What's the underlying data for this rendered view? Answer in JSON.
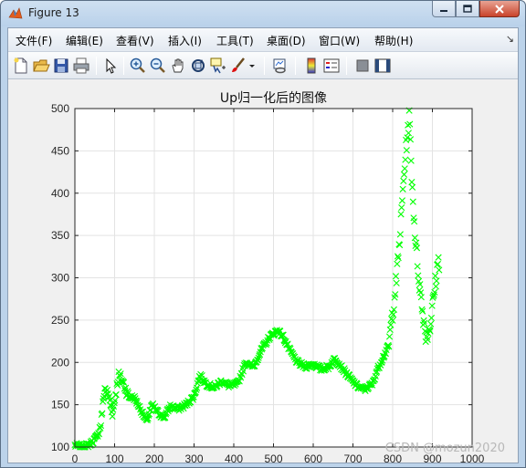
{
  "window": {
    "title": "Figure 13"
  },
  "menu": [
    {
      "label": "文件(F)"
    },
    {
      "label": "编辑(E)"
    },
    {
      "label": "查看(V)"
    },
    {
      "label": "插入(I)"
    },
    {
      "label": "工具(T)"
    },
    {
      "label": "桌面(D)"
    },
    {
      "label": "窗口(W)"
    },
    {
      "label": "帮助(H)"
    }
  ],
  "toolbar": {
    "icons": [
      "new-figure-icon",
      "open-icon",
      "save-icon",
      "print-icon",
      "pointer-icon",
      "zoom-in-icon",
      "zoom-out-icon",
      "pan-icon",
      "rotate-3d-icon",
      "data-cursor-icon",
      "brush-icon",
      "link-plot-icon",
      "colorbar-icon",
      "legend-icon",
      "hide-plot-tools-icon",
      "show-plot-tools-icon"
    ]
  },
  "watermark": "CSDN @mozun2020",
  "chart_data": {
    "type": "scatter",
    "title": "Up归一化后的图像",
    "xlabel": "",
    "ylabel": "",
    "xlim": [
      0,
      1000
    ],
    "ylim": [
      100,
      500
    ],
    "xticks": [
      0,
      100,
      200,
      300,
      400,
      500,
      600,
      700,
      800,
      900,
      1000
    ],
    "yticks": [
      100,
      150,
      200,
      250,
      300,
      350,
      400,
      450,
      500
    ],
    "grid": true,
    "marker": "x",
    "color": "#00ff00",
    "trend": [
      [
        0,
        102
      ],
      [
        20,
        100
      ],
      [
        40,
        104
      ],
      [
        55,
        112
      ],
      [
        65,
        125
      ],
      [
        75,
        170
      ],
      [
        85,
        160
      ],
      [
        95,
        140
      ],
      [
        110,
        185
      ],
      [
        120,
        178
      ],
      [
        135,
        160
      ],
      [
        150,
        158
      ],
      [
        165,
        145
      ],
      [
        180,
        130
      ],
      [
        195,
        150
      ],
      [
        210,
        140
      ],
      [
        225,
        135
      ],
      [
        240,
        148
      ],
      [
        260,
        145
      ],
      [
        280,
        150
      ],
      [
        300,
        160
      ],
      [
        315,
        185
      ],
      [
        330,
        175
      ],
      [
        350,
        170
      ],
      [
        370,
        178
      ],
      [
        390,
        172
      ],
      [
        410,
        175
      ],
      [
        430,
        200
      ],
      [
        450,
        195
      ],
      [
        470,
        215
      ],
      [
        490,
        230
      ],
      [
        510,
        238
      ],
      [
        525,
        230
      ],
      [
        540,
        215
      ],
      [
        560,
        200
      ],
      [
        580,
        195
      ],
      [
        600,
        198
      ],
      [
        620,
        192
      ],
      [
        640,
        195
      ],
      [
        655,
        205
      ],
      [
        670,
        195
      ],
      [
        690,
        183
      ],
      [
        710,
        172
      ],
      [
        730,
        168
      ],
      [
        750,
        175
      ],
      [
        760,
        190
      ],
      [
        775,
        205
      ],
      [
        790,
        220
      ],
      [
        800,
        260
      ],
      [
        810,
        300
      ],
      [
        820,
        360
      ],
      [
        828,
        420
      ],
      [
        835,
        460
      ],
      [
        842,
        490
      ],
      [
        850,
        400
      ],
      [
        858,
        340
      ],
      [
        866,
        300
      ],
      [
        875,
        260
      ],
      [
        885,
        230
      ],
      [
        895,
        245
      ],
      [
        905,
        285
      ],
      [
        915,
        320
      ]
    ]
  }
}
